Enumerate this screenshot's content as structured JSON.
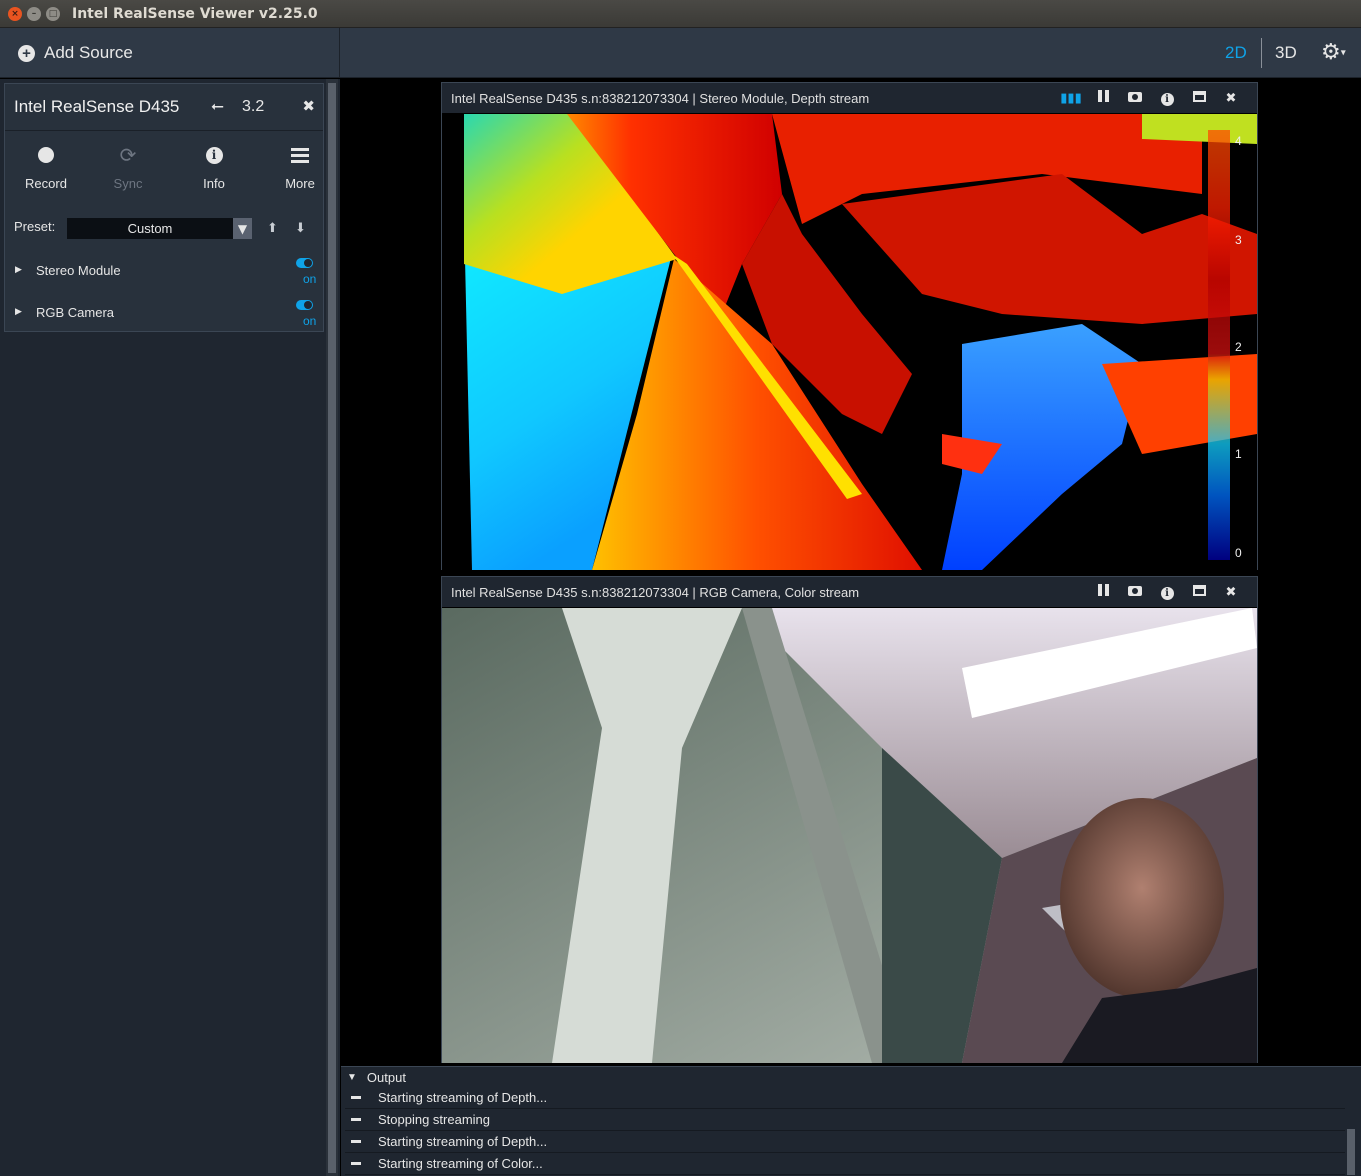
{
  "window": {
    "title": "Intel RealSense Viewer v2.25.0"
  },
  "topbar": {
    "add_source": "Add Source",
    "view_2d": "2D",
    "view_3d": "3D",
    "accent": "#0fa3e8"
  },
  "device": {
    "name": "Intel RealSense D435",
    "usb_version": "3.2",
    "tools": [
      {
        "label": "Record",
        "icon": "record-icon",
        "enabled": true
      },
      {
        "label": "Sync",
        "icon": "sync-icon",
        "enabled": false
      },
      {
        "label": "Info",
        "icon": "info-icon",
        "enabled": true
      },
      {
        "label": "More",
        "icon": "menu-icon",
        "enabled": true
      }
    ],
    "preset_label": "Preset:",
    "preset_value": "Custom",
    "sensors": [
      {
        "name": "Stereo Module",
        "state": "on"
      },
      {
        "name": "RGB Camera",
        "state": "on"
      }
    ]
  },
  "streams": {
    "depth": {
      "title": "Intel RealSense D435 s.n:838212073304 | Stereo Module, Depth stream",
      "colorbar_labels": [
        "4",
        "3",
        "2",
        "1",
        "0"
      ]
    },
    "color": {
      "title": "Intel RealSense D435 s.n:838212073304 | RGB Camera, Color stream"
    }
  },
  "output": {
    "label": "Output",
    "lines": [
      "Starting streaming of Depth...",
      "Stopping streaming",
      "Starting streaming of Depth...",
      "Starting streaming of Color..."
    ]
  }
}
